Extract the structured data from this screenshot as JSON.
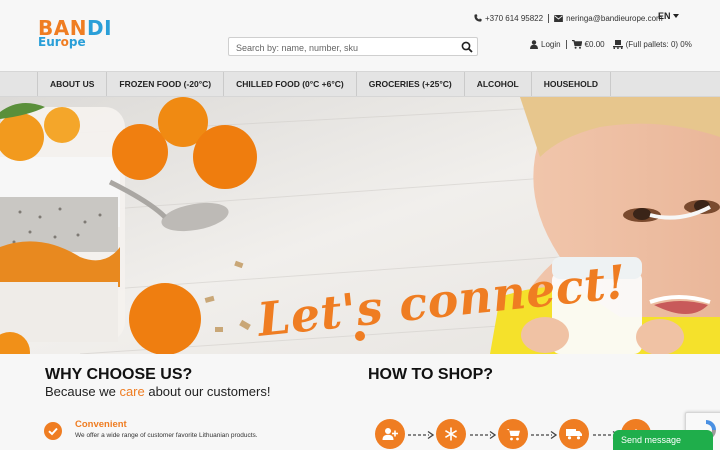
{
  "header": {
    "logo_main_a": "BANDI",
    "logo_sub": "Europe",
    "phone": "+370 614 95822",
    "email": "neringa@bandieurope.com",
    "language": "EN",
    "search_placeholder": "Search by: name, number, sku",
    "login": "Login",
    "cart_total": "€0.00",
    "pallets": "(Full pallets: 0) 0%"
  },
  "nav": {
    "items": [
      {
        "label": "ABOUT US"
      },
      {
        "label": "FROZEN FOOD (-20°C)"
      },
      {
        "label": "CHILLED FOOD (0°C +6°C)"
      },
      {
        "label": "GROCERIES (+25°C)"
      },
      {
        "label": "ALCOHOL"
      },
      {
        "label": "HOUSEHOLD"
      }
    ]
  },
  "hero": {
    "slogan": "Let's connect!"
  },
  "why": {
    "title": "WHY CHOOSE US?",
    "sub_before": "Because we ",
    "sub_highlight": "care",
    "sub_after": " about our customers!",
    "feature_title": "Convenient",
    "feature_desc": "We offer a wide range of customer favorite Lithuanian products."
  },
  "how": {
    "title": "HOW TO SHOP?",
    "steps": [
      "add-user-icon",
      "snowflake-icon",
      "cart-icon",
      "truck-icon",
      "arrow-up-icon"
    ]
  },
  "chat": {
    "label": "Send message"
  },
  "colors": {
    "accent": "#ef7d22",
    "brand_blue": "#2a9fd8",
    "chat_green": "#1fae4b"
  }
}
